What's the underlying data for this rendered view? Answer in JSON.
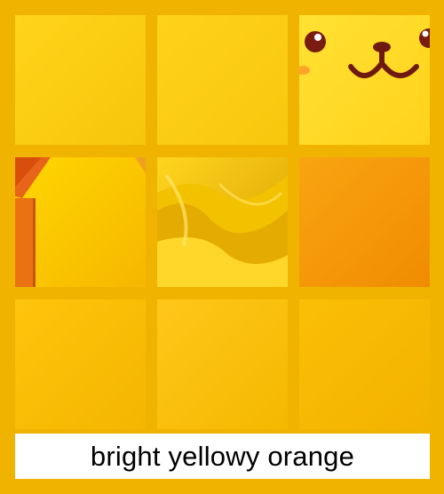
{
  "caption": {
    "text": "bright yellowy orange"
  },
  "colors": {
    "frame": "#F0B400",
    "caption_bg": "#FFFFFF",
    "caption_text": "#000000"
  },
  "tiles": [
    {
      "name": "tile-plain-yellow-1",
      "type": "plain",
      "c1": "#FFD41A",
      "c2": "#F6C50C"
    },
    {
      "name": "tile-plain-yellow-2",
      "type": "plain",
      "c1": "#FFD21A",
      "c2": "#F7C70E"
    },
    {
      "name": "tile-cartoon-face",
      "type": "face",
      "c1": "#FFE233",
      "c2": "#FFD21C"
    },
    {
      "name": "tile-house-painting",
      "type": "house",
      "c1": "#FFD600",
      "c2": "#F6B700"
    },
    {
      "name": "tile-silk-fabric",
      "type": "silk",
      "c1": "#FFD51E",
      "c2": "#D9A000"
    },
    {
      "name": "tile-orange-texture",
      "type": "plain",
      "c1": "#F9A411",
      "c2": "#F08C00"
    },
    {
      "name": "tile-plain-yellow-3",
      "type": "plain",
      "c1": "#FFC40C",
      "c2": "#F4B600"
    },
    {
      "name": "tile-plain-yellow-4",
      "type": "plain",
      "c1": "#FFC71A",
      "c2": "#F4B800"
    },
    {
      "name": "tile-plain-yellow-5",
      "type": "plain",
      "c1": "#FBBF06",
      "c2": "#F3B200"
    }
  ]
}
